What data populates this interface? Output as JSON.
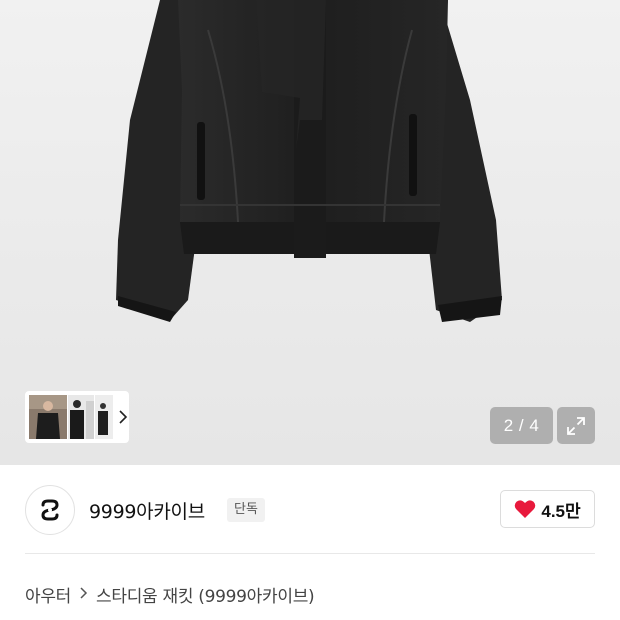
{
  "gallery": {
    "page_current": "2",
    "page_total": "4",
    "page_counter": "2 / 4",
    "thumbnails": [
      "thumbnail-1",
      "thumbnail-2",
      "thumbnail-3"
    ],
    "next_icon": "chevron-right-icon",
    "expand_icon": "expand-icon"
  },
  "brand": {
    "name": "9999아카이브",
    "badge": "단독",
    "logo_icon": "brand-logo-icon"
  },
  "like": {
    "icon": "heart-icon",
    "count": "4.5만",
    "color": "#e8193c"
  },
  "breadcrumb": {
    "category": "아우터",
    "separator_icon": "chevron-right-icon",
    "product": "스타디움 재킷 (9999아카이브)"
  }
}
